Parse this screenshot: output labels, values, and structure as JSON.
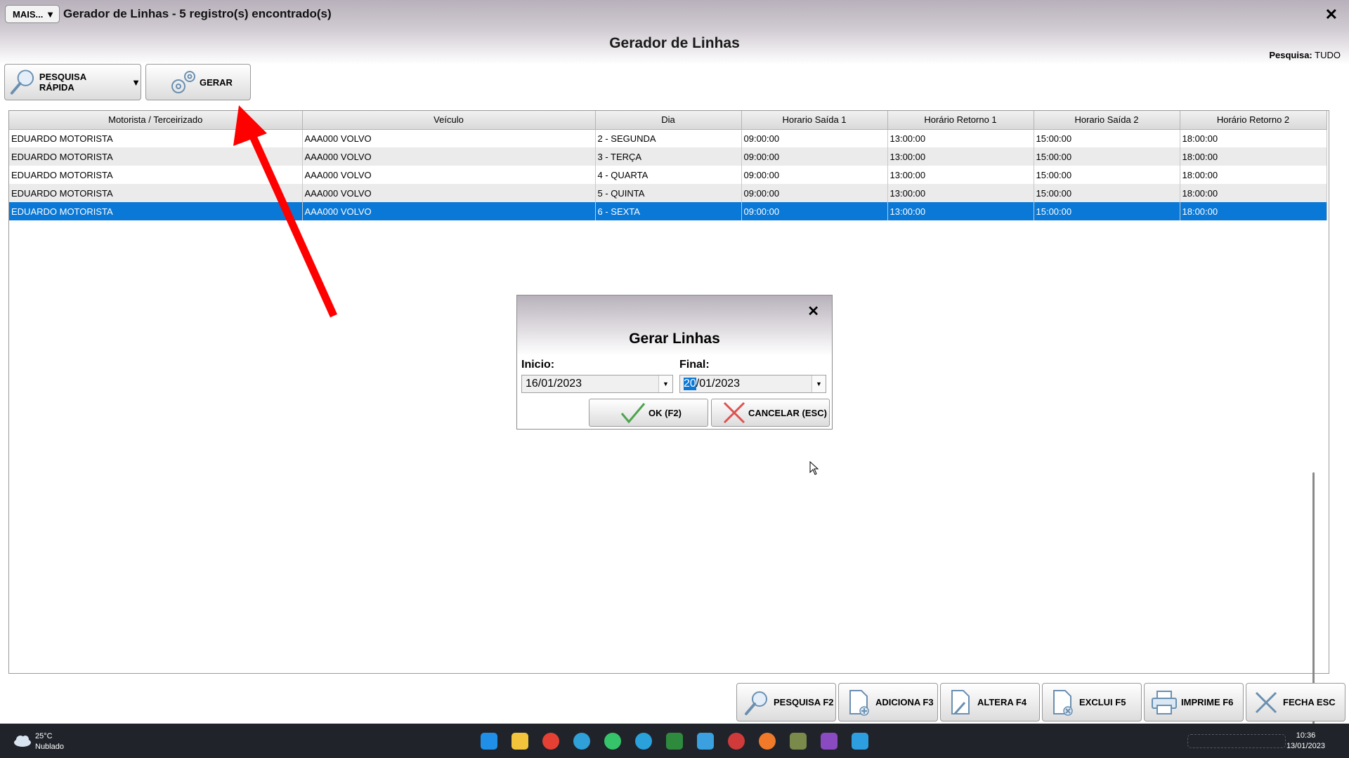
{
  "window": {
    "mais_label": "MAIS...",
    "title": "Gerador de Linhas - 5 registro(s) encontrado(s)",
    "close_glyph": "✕"
  },
  "page": {
    "title": "Gerador de Linhas",
    "pesquisa_label": "Pesquisa:",
    "pesquisa_value": "TUDO"
  },
  "toolbar": {
    "pesquisa_rapida": "PESQUISA RÁPIDA",
    "dropdown_glyph": "▼",
    "gerar": "GERAR"
  },
  "grid": {
    "columns": [
      "Motorista / Terceirizado",
      "Veículo",
      "Dia",
      "Horario Saída 1",
      "Horário Retorno 1",
      "Horario Saída 2",
      "Horário Retorno 2"
    ],
    "rows": [
      [
        "EDUARDO MOTORISTA",
        "AAA000 VOLVO",
        "2 - SEGUNDA",
        "09:00:00",
        "13:00:00",
        "15:00:00",
        "18:00:00"
      ],
      [
        "EDUARDO MOTORISTA",
        "AAA000 VOLVO",
        "3 - TERÇA",
        "09:00:00",
        "13:00:00",
        "15:00:00",
        "18:00:00"
      ],
      [
        "EDUARDO MOTORISTA",
        "AAA000 VOLVO",
        "4 - QUARTA",
        "09:00:00",
        "13:00:00",
        "15:00:00",
        "18:00:00"
      ],
      [
        "EDUARDO MOTORISTA",
        "AAA000 VOLVO",
        "5 - QUINTA",
        "09:00:00",
        "13:00:00",
        "15:00:00",
        "18:00:00"
      ],
      [
        "EDUARDO MOTORISTA",
        "AAA000 VOLVO",
        "6 - SEXTA",
        "09:00:00",
        "13:00:00",
        "15:00:00",
        "18:00:00"
      ]
    ],
    "selected_row": 4
  },
  "dialog": {
    "title": "Gerar Linhas",
    "close_glyph": "✕",
    "inicio_label": "Inicio:",
    "inicio_value": "16/01/2023",
    "final_label": "Final:",
    "final_value_selected": "20",
    "final_value_rest": "/01/2023",
    "ok_label": "OK (F2)",
    "cancel_label": "CANCELAR (ESC)"
  },
  "bottom_buttons": {
    "pesquisa": "PESQUISA F2",
    "adiciona": "ADICIONA F3",
    "altera": "ALTERA F4",
    "exclui": "EXCLUI F5",
    "imprime": "IMPRIME F6",
    "fecha": "FECHA ESC"
  },
  "taskbar": {
    "temperature": "25°C",
    "weather": "Nublado",
    "time": "10:36",
    "date": "13/01/2023"
  },
  "colors": {
    "accent": "#0a78d6",
    "annotation_arrow": "#ff0000"
  }
}
